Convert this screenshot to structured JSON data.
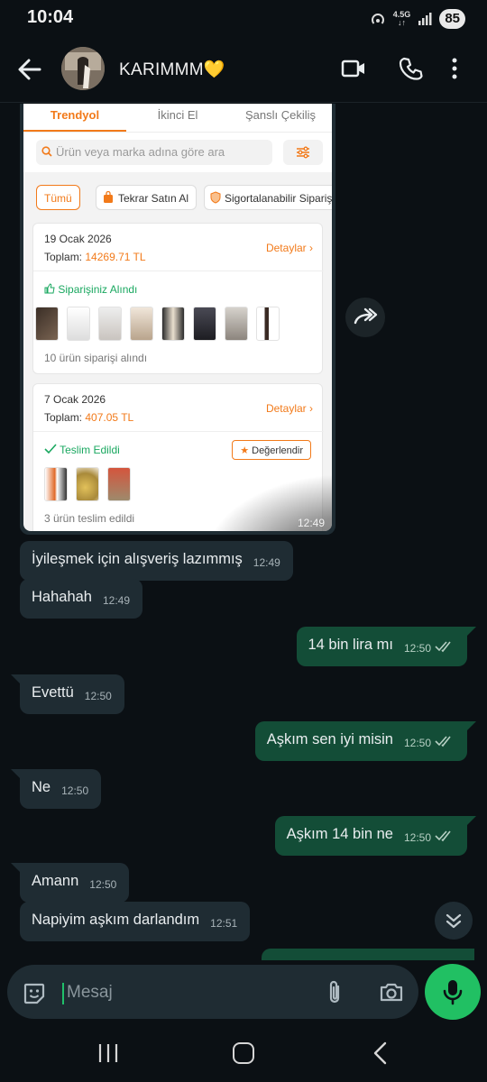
{
  "status_bar": {
    "time": "10:04",
    "network": "4.5G",
    "battery": "85"
  },
  "header": {
    "contact_name": "KARIMMM💛"
  },
  "shared_screenshot": {
    "tabs": [
      "Trendyol",
      "İkinci El",
      "Şanslı Çekiliş"
    ],
    "search_placeholder": "Ürün veya marka adına göre ara",
    "chips": [
      "Tümü",
      "Tekrar Satın Al",
      "Sigortalanabilir Siparişl"
    ],
    "orders": [
      {
        "date": "19 Ocak 2026",
        "total_label": "Toplam:",
        "total_value": "14269.71 TL",
        "details": "Detaylar",
        "status": "Siparişiniz Alındı",
        "note": "10 ürün siparişi alındı"
      },
      {
        "date": "7 Ocak 2026",
        "total_label": "Toplam:",
        "total_value": "407.05 TL",
        "details": "Detaylar",
        "status": "Teslim Edildi",
        "rate_label": "Değerlendir",
        "note": "3 ürün teslim edildi"
      }
    ],
    "time": "12:49"
  },
  "messages": [
    {
      "text": "İyileşmek için alışveriş lazımmış",
      "time": "12:49"
    },
    {
      "text": "Hahahah",
      "time": "12:49"
    },
    {
      "text": "14 bin lira mı",
      "time": "12:50"
    },
    {
      "text": "Evettü",
      "time": "12:50"
    },
    {
      "text": "Aşkım sen iyi misin",
      "time": "12:50"
    },
    {
      "text": "Ne",
      "time": "12:50"
    },
    {
      "text": "Aşkım 14 bin ne",
      "time": "12:50"
    },
    {
      "text": "Amann",
      "time": "12:50"
    },
    {
      "text": "Napiyim aşkım darlandım",
      "time": "12:51"
    }
  ],
  "composer": {
    "placeholder": "Mesaj"
  },
  "colors": {
    "incoming": "#1f2c33",
    "outgoing": "#134d37",
    "accent": "#21c063",
    "trendyol_orange": "#f27a1a"
  }
}
